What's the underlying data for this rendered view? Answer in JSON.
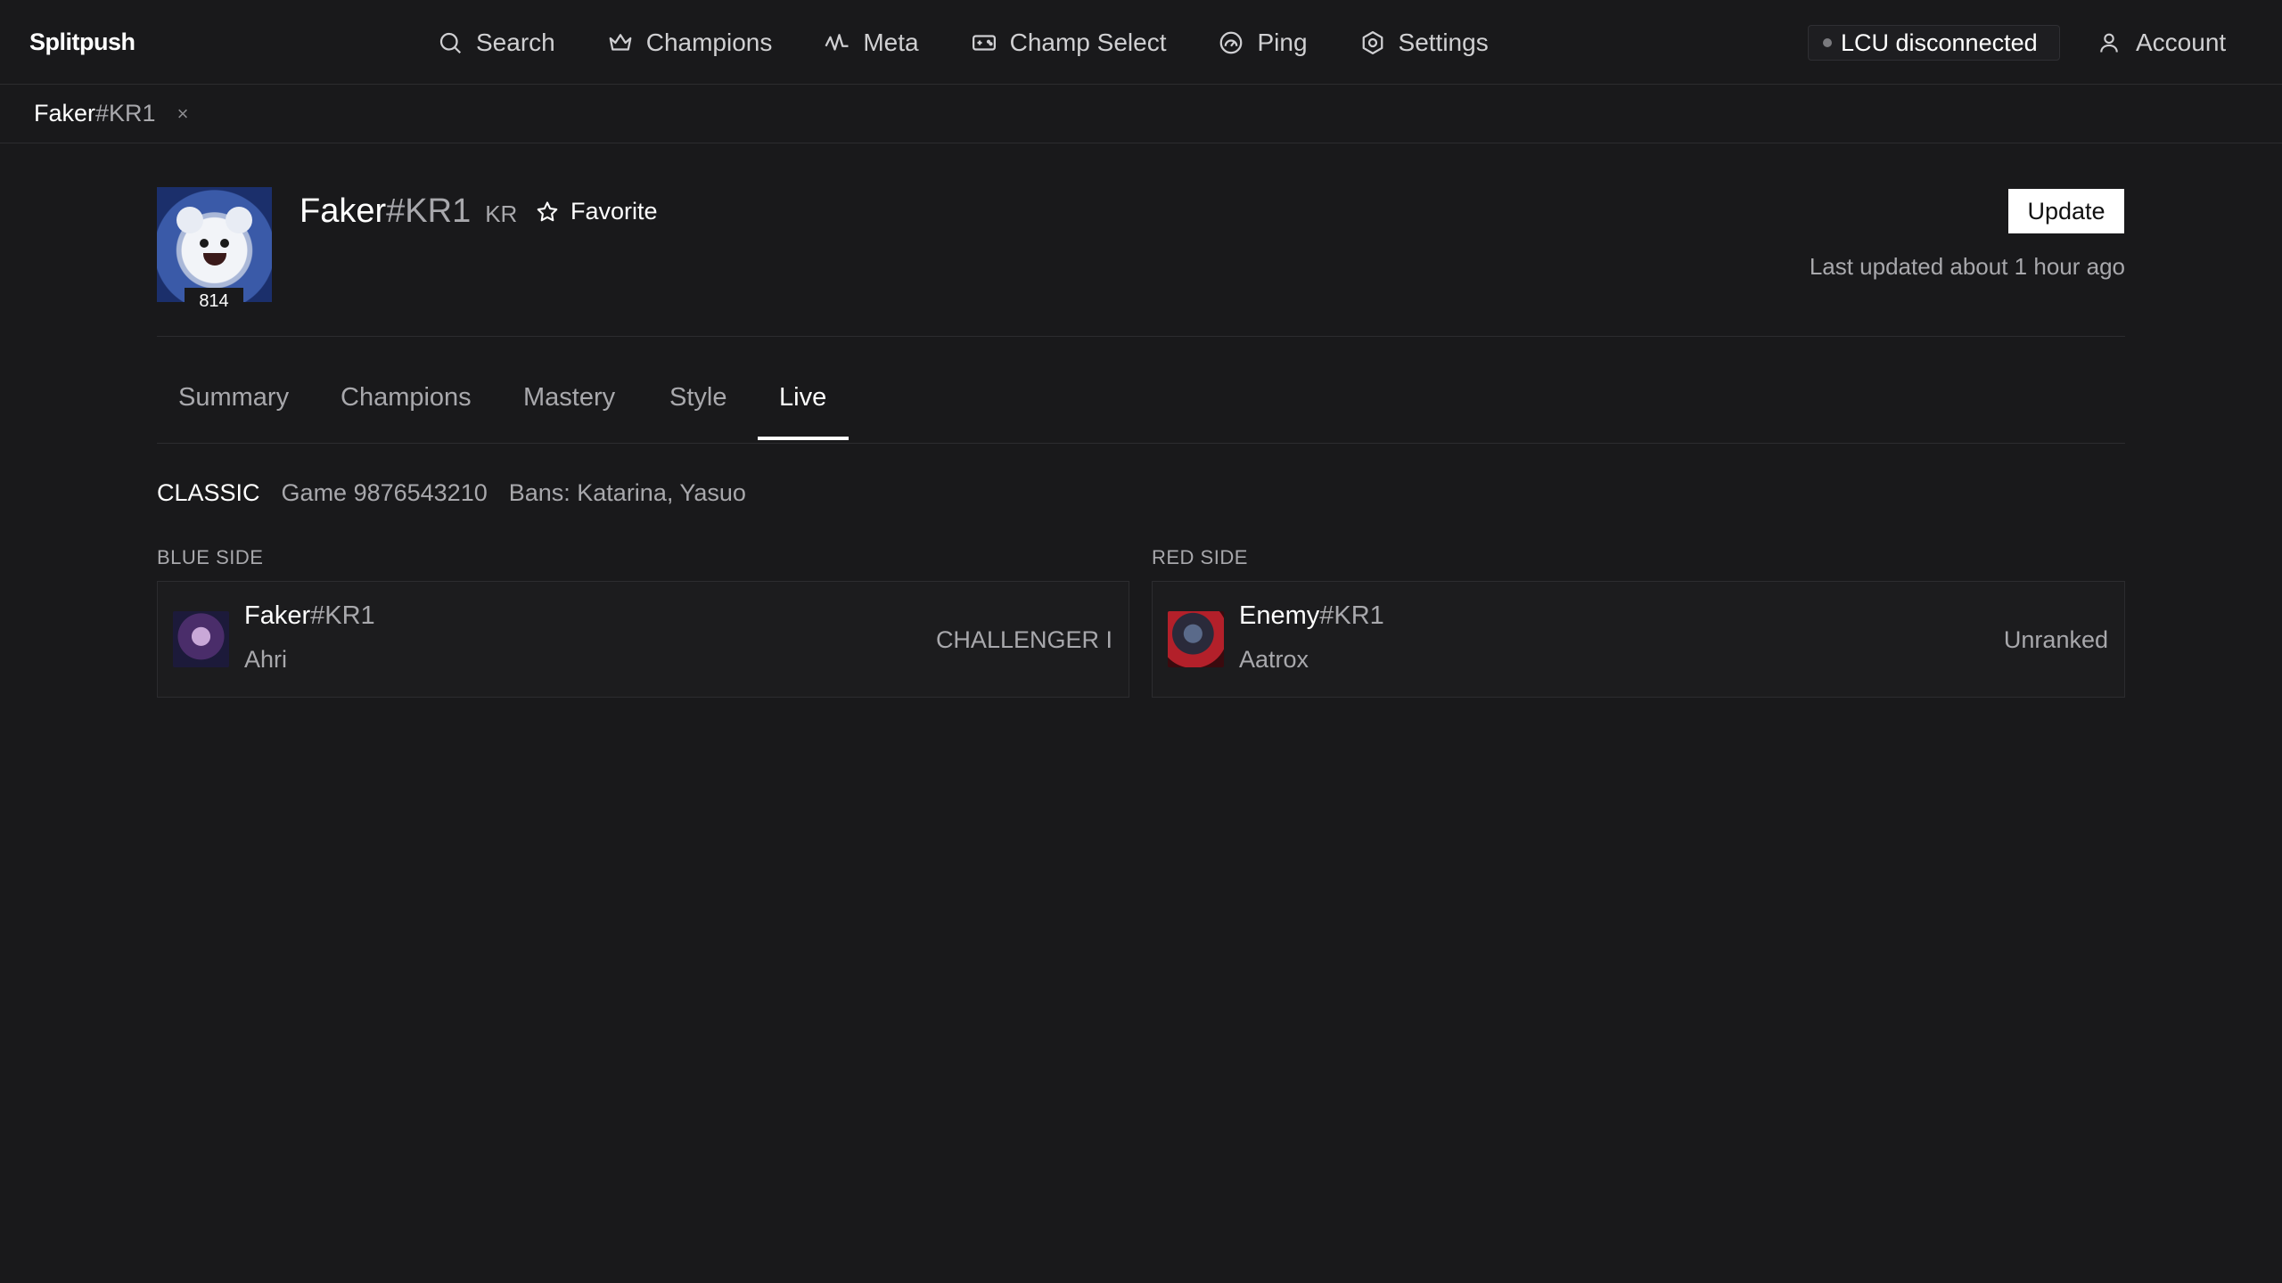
{
  "app": {
    "brand": "Splitpush"
  },
  "nav": {
    "items": [
      {
        "label": "Search",
        "icon": "search-icon"
      },
      {
        "label": "Champions",
        "icon": "crown-icon"
      },
      {
        "label": "Meta",
        "icon": "activity-icon"
      },
      {
        "label": "Champ Select",
        "icon": "gamepad-icon"
      },
      {
        "label": "Ping",
        "icon": "gauge-icon"
      },
      {
        "label": "Settings",
        "icon": "gear-icon"
      }
    ],
    "lcu_status": "LCU disconnected",
    "account_label": "Account"
  },
  "open_tabs": [
    {
      "name": "Faker",
      "tag": "#KR1",
      "close": "×"
    }
  ],
  "profile": {
    "name": "Faker",
    "tag": "#KR1",
    "region": "KR",
    "level": "814",
    "favorite_label": "Favorite",
    "update_label": "Update",
    "last_updated": "Last updated about 1 hour ago"
  },
  "subtabs": [
    {
      "label": "Summary",
      "active": false
    },
    {
      "label": "Champions",
      "active": false
    },
    {
      "label": "Mastery",
      "active": false
    },
    {
      "label": "Style",
      "active": false
    },
    {
      "label": "Live",
      "active": true
    }
  ],
  "live": {
    "mode": "CLASSIC",
    "game_id": "Game 9876543210",
    "bans": "Bans: Katarina, Yasuo",
    "blue_side": {
      "label": "BLUE SIDE",
      "players": [
        {
          "name": "Faker",
          "tag": "#KR1",
          "champion": "Ahri",
          "rank": "CHALLENGER I"
        }
      ]
    },
    "red_side": {
      "label": "RED SIDE",
      "players": [
        {
          "name": "Enemy",
          "tag": "#KR1",
          "champion": "Aatrox",
          "rank": "Unranked"
        }
      ]
    }
  }
}
